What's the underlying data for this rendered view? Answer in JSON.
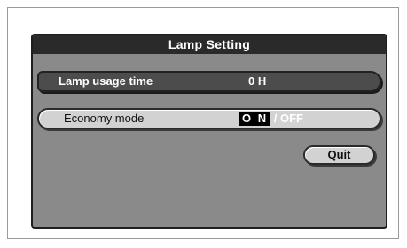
{
  "dialog": {
    "title": "Lamp Setting",
    "lamp_usage": {
      "label": "Lamp usage time",
      "value": "0 H"
    },
    "economy_mode": {
      "label": "Economy mode",
      "option_on": "O N",
      "separator": "/",
      "option_off": "OFF",
      "selected": "ON"
    },
    "quit_label": "Quit"
  },
  "colors": {
    "panel": "#8a8a8a",
    "header": "#2a2a2a",
    "selected_row": "#4c4c4c",
    "button_face": "#d2d2d2"
  }
}
